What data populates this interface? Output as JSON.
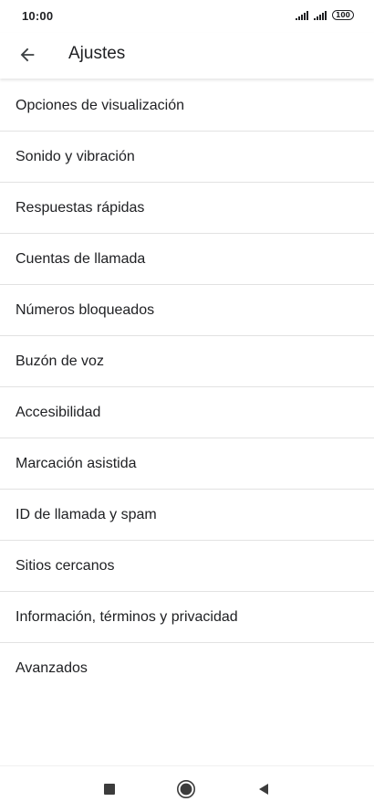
{
  "status_bar": {
    "time": "10:00",
    "battery": "100"
  },
  "app_bar": {
    "title": "Ajustes",
    "back_icon": "arrow-back-icon"
  },
  "settings": {
    "items": [
      {
        "label": "Opciones de visualización"
      },
      {
        "label": "Sonido y vibración"
      },
      {
        "label": "Respuestas rápidas"
      },
      {
        "label": "Cuentas de llamada"
      },
      {
        "label": "Números bloqueados"
      },
      {
        "label": "Buzón de voz"
      },
      {
        "label": "Accesibilidad"
      },
      {
        "label": "Marcación asistida"
      },
      {
        "label": "ID de llamada y spam"
      },
      {
        "label": "Sitios cercanos"
      },
      {
        "label": "Información, términos y privacidad"
      },
      {
        "label": "Avanzados"
      }
    ]
  },
  "nav_bar": {
    "recents_icon": "square-recents-icon",
    "home_icon": "circle-home-icon",
    "back_icon": "triangle-back-icon"
  },
  "colors": {
    "text": "#202124",
    "divider": "#e2e2e2",
    "background": "#ffffff",
    "nav_icon": "#3c3c3c"
  }
}
